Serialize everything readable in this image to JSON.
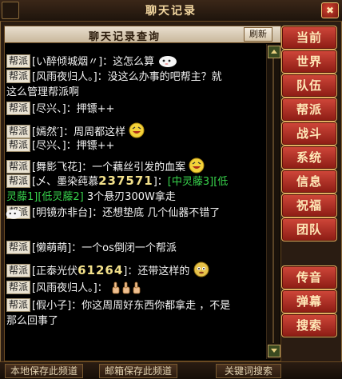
{
  "window": {
    "title": "聊天记录",
    "close_symbol": "✖"
  },
  "panel": {
    "title": "聊天记录查询",
    "refresh_label": "刷新"
  },
  "messages": [
    {
      "tag": "帮派",
      "text": "[い醉倾城烟〃]：这怎么算",
      "emoji": "sheep"
    },
    {
      "tag": "帮派",
      "text": "[风雨夜归人。]：没这么办事的吧帮主？就",
      "cont": "这么管理帮派啊"
    },
    {
      "tag": "帮派",
      "text": "[尽兴、]：押镖++"
    },
    {
      "tag": "帮派",
      "text": "[嫣然′]：周周都这样",
      "emoji": "face"
    },
    {
      "tag": "帮派",
      "text": "[尽兴、]：押镖++"
    },
    {
      "tag": "帮派",
      "text": "[舞影飞花]：一个藕丝引发的血案",
      "emoji": "face"
    },
    {
      "tag": "帮派",
      "pre": "[乄、墨染莼慕",
      "score": "237571",
      "post": "]：",
      "green1": "[中灵藤3][低",
      "green2": "灵藤1][低灵藤2]",
      "tail": " 3个悬刃300W拿走"
    },
    {
      "tag": "帮派",
      "text": "[明镜亦非台]：还想垫底 几个仙器不错了",
      "emoji": "sheep"
    },
    {
      "tag": "帮派",
      "text": "[懒萌萌]：一个os倒闭一个帮派"
    },
    {
      "tag": "帮派",
      "pre": "[正泰光伏",
      "score": "61264",
      "post": "]：还带这样的",
      "emoji": "face2"
    },
    {
      "tag": "帮派",
      "text": "[风雨夜归人。]：",
      "emoji": "thumbs"
    },
    {
      "tag": "帮派",
      "text": "[假小子]：你这周周好东西你都拿走 ，不是",
      "cont": "那么回事了"
    }
  ],
  "side_buttons": [
    "当前",
    "世界",
    "队伍",
    "帮派",
    "战斗",
    "系统",
    "信息",
    "祝福",
    "团队",
    "传音",
    "弹幕",
    "搜索"
  ],
  "footer": {
    "save_local": "本地保存此频道",
    "save_mail": "邮箱保存此频道",
    "keyword_search": "关键词搜索"
  },
  "colors": {
    "accent_red": "#b8382c",
    "green_text": "#37d24b",
    "score_yellow": "#f2e08a"
  }
}
